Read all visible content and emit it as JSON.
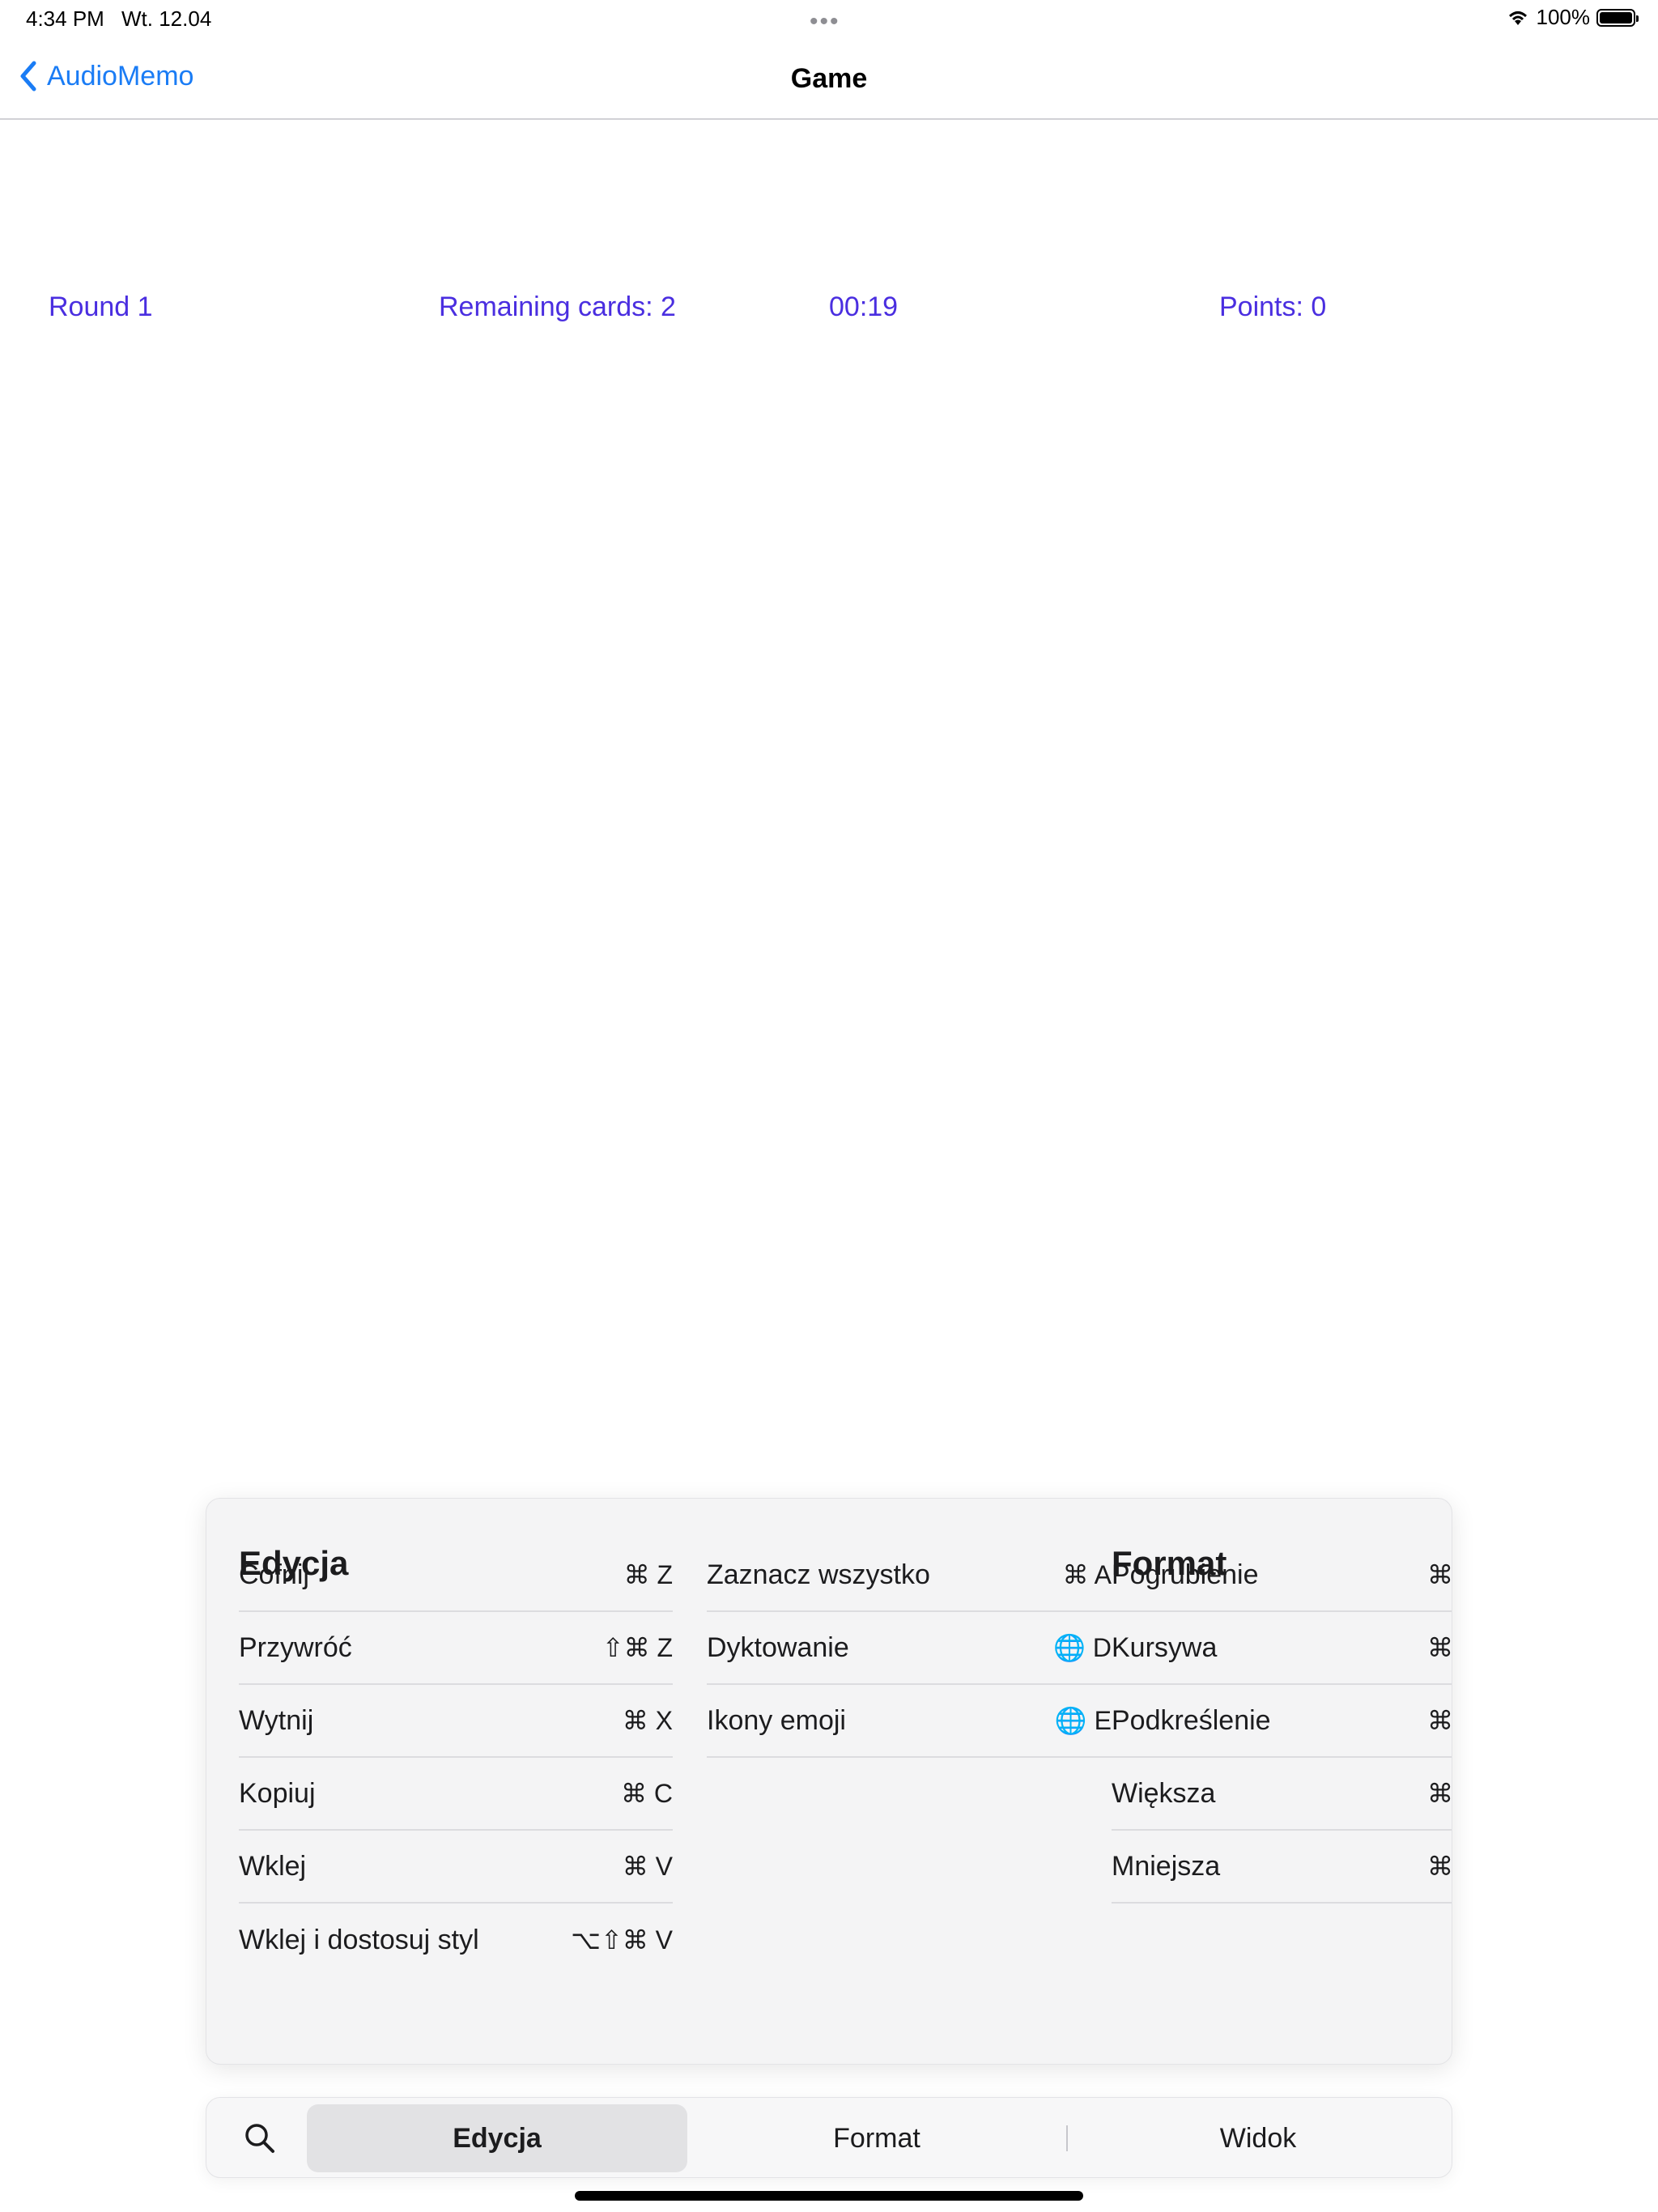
{
  "status_bar": {
    "time": "4:34 PM",
    "date": "Wt. 12.04",
    "battery": "100%",
    "battery_level": 1.0
  },
  "nav": {
    "back_label": "AudioMemo",
    "title": "Game"
  },
  "game": {
    "round": "Round 1",
    "remaining": "Remaining cards: 2",
    "timer": "00:19",
    "points": "Points: 0"
  },
  "menu": {
    "edit_heading": "Edycja",
    "edit_items": [
      {
        "label": "Cofnij",
        "shortcut": "⌘ Z"
      },
      {
        "label": "Przywróć",
        "shortcut": "⇧⌘ Z"
      },
      {
        "label": "Wytnij",
        "shortcut": "⌘ X"
      },
      {
        "label": "Kopiuj",
        "shortcut": "⌘ C"
      },
      {
        "label": "Wklej",
        "shortcut": "⌘ V"
      },
      {
        "label": "Wklej i dostosuj styl",
        "shortcut": "⌥⇧⌘ V"
      }
    ],
    "edit_items2": [
      {
        "label": "Zaznacz wszystko",
        "shortcut": "⌘ A"
      },
      {
        "label": "Dyktowanie",
        "shortcut": "🌐 D"
      },
      {
        "label": "Ikony emoji",
        "shortcut": "🌐 E"
      }
    ],
    "format_heading": "Format",
    "format_items": [
      {
        "label": "Pogrubienie",
        "shortcut": "⌘"
      },
      {
        "label": "Kursywa",
        "shortcut": "⌘"
      },
      {
        "label": "Podkreślenie",
        "shortcut": "⌘"
      },
      {
        "label": "Większa",
        "shortcut": "⌘"
      },
      {
        "label": "Mniejsza",
        "shortcut": "⌘"
      }
    ]
  },
  "tabs": {
    "edit": "Edycja",
    "format": "Format",
    "view": "Widok"
  },
  "colors": {
    "accent": "#1a7cf5",
    "game_text": "#4a2ee0"
  }
}
